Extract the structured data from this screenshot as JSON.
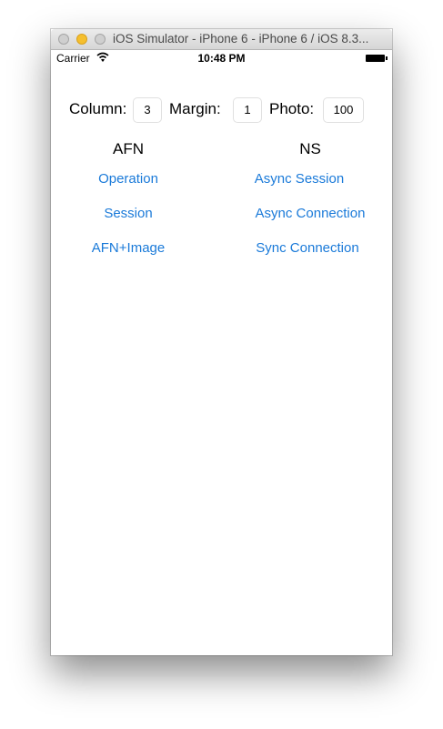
{
  "window": {
    "title": "iOS Simulator - iPhone 6 - iPhone 6 / iOS 8.3..."
  },
  "status_bar": {
    "carrier": "Carrier",
    "time": "10:48 PM"
  },
  "params": {
    "column_label": "Column:",
    "column_value": "3",
    "margin_label": "Margin:",
    "margin_value": "1",
    "photo_label": "Photo:",
    "photo_value": "100"
  },
  "columns": {
    "afn_header": "AFN",
    "ns_header": "NS"
  },
  "afn_buttons": [
    "Operation",
    "Session",
    "AFN+Image"
  ],
  "ns_buttons": [
    "Async Session",
    "Async Connection",
    "Sync Connection"
  ],
  "colors": {
    "button_text": "#1a7ad9"
  }
}
